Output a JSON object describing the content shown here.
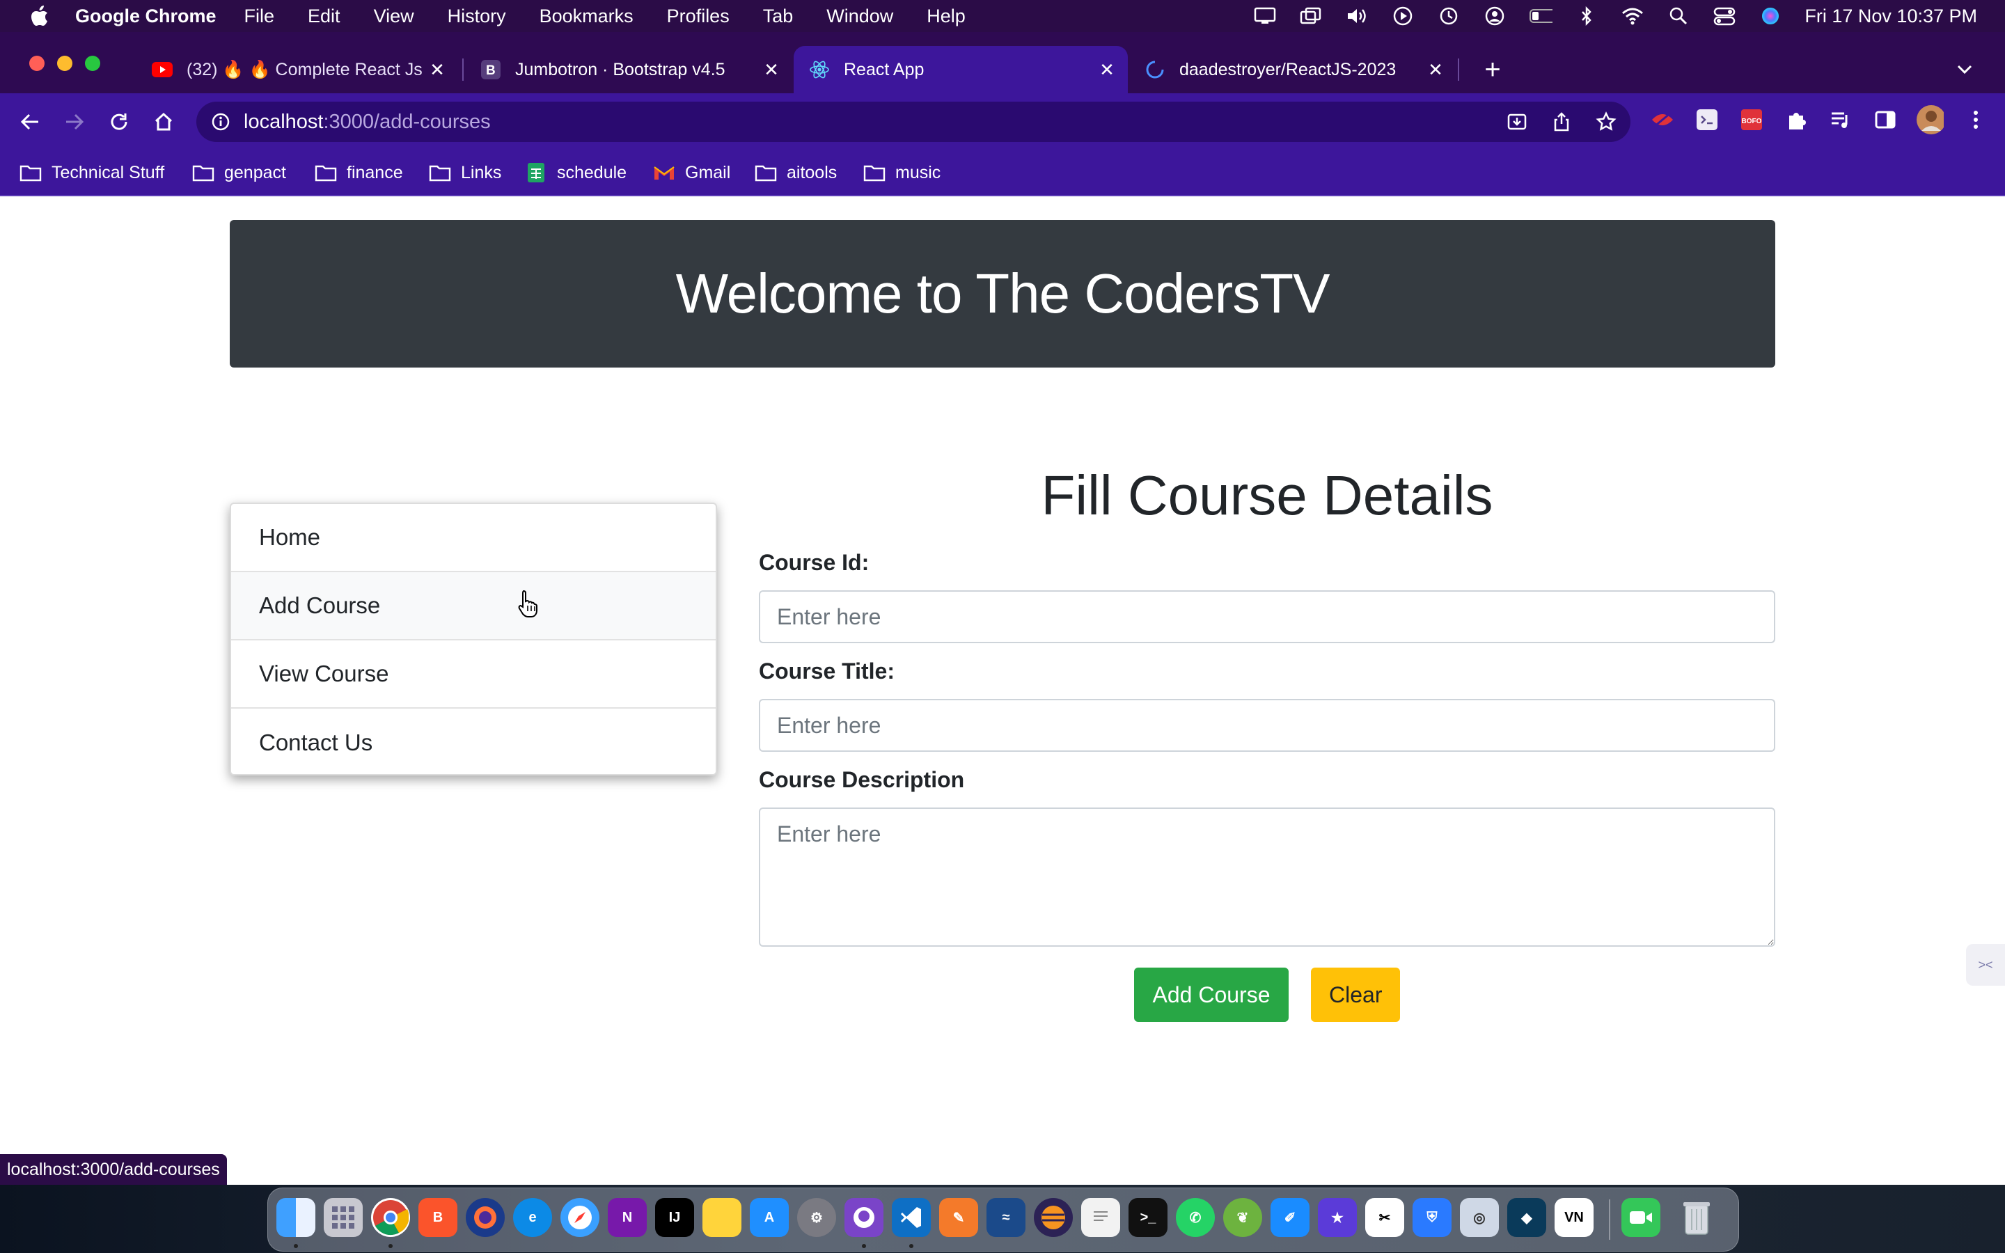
{
  "menubar": {
    "app_name": "Google Chrome",
    "menus": [
      "File",
      "Edit",
      "View",
      "History",
      "Bookmarks",
      "Profiles",
      "Tab",
      "Window",
      "Help"
    ],
    "clock": "Fri 17 Nov  10:37 PM"
  },
  "tabs": [
    {
      "title": "(32) 🔥 🔥 Complete React Js",
      "icon": "youtube-icon"
    },
    {
      "title": "Jumbotron · Bootstrap v4.5",
      "icon": "bootstrap-icon"
    },
    {
      "title": "React App",
      "icon": "react-icon",
      "active": true
    },
    {
      "title": "daadestroyer/ReactJS-2023",
      "icon": "loading-spinner-icon"
    }
  ],
  "address": {
    "host": "localhost",
    "path": ":3000/add-courses"
  },
  "bookmarks": [
    {
      "label": "Technical Stuff",
      "icon": "folder-icon"
    },
    {
      "label": "genpact",
      "icon": "folder-icon"
    },
    {
      "label": "finance",
      "icon": "folder-icon"
    },
    {
      "label": "Links",
      "icon": "folder-icon"
    },
    {
      "label": "schedule",
      "icon": "sheets-icon"
    },
    {
      "label": "Gmail",
      "icon": "gmail-icon"
    },
    {
      "label": "aitools",
      "icon": "folder-icon"
    },
    {
      "label": "music",
      "icon": "folder-icon"
    }
  ],
  "page": {
    "header": "Welcome to The CodersTV",
    "nav": [
      "Home",
      "Add Course",
      "View Course",
      "Contact Us"
    ],
    "form": {
      "title": "Fill Course Details",
      "id_label": "Course Id:",
      "title_label": "Course Title:",
      "desc_label": "Course Description",
      "placeholder": "Enter here",
      "add_button": "Add Course",
      "clear_button": "Clear"
    }
  },
  "status_url": "localhost:3000/add-courses",
  "extensions": [
    {
      "label": "BOFO"
    }
  ],
  "colors": {
    "jumbotron": "#343a40",
    "success": "#28a745",
    "warning": "#ffc107",
    "chrome_theme": "#3d169b"
  }
}
